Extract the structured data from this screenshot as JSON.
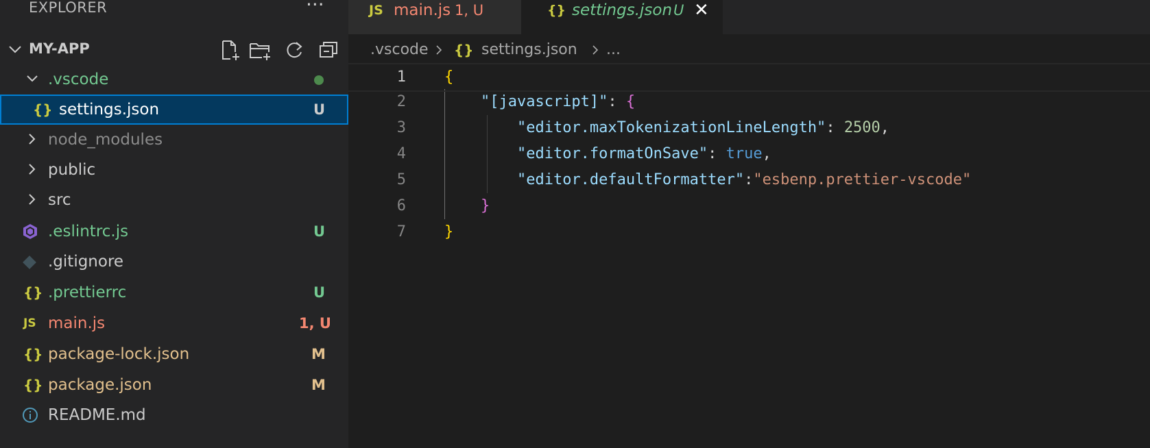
{
  "colors": {
    "sidebar_bg": "#252526",
    "editor_bg": "#1e1e1e",
    "selection_bg": "#04395e",
    "focus_border": "#007fd4",
    "untracked": "#73c991",
    "modified": "#e2c08d",
    "error": "#f48771",
    "ignored": "#8c8c8c"
  },
  "explorer": {
    "title": "EXPLORER",
    "more_actions": "···",
    "section_title": "MY-APP",
    "actions": [
      "new-file-icon",
      "new-folder-icon",
      "refresh-icon",
      "collapse-all-icon"
    ],
    "items": [
      {
        "name": ".vscode",
        "kind": "folder",
        "expanded": true,
        "badge": "",
        "decoration": "untracked-dot"
      },
      {
        "name": "settings.json",
        "kind": "json",
        "icon": "{}",
        "badge": "U",
        "selected": true
      },
      {
        "name": "node_modules",
        "kind": "folder",
        "expanded": false,
        "badge": ""
      },
      {
        "name": "public",
        "kind": "folder",
        "expanded": false,
        "badge": ""
      },
      {
        "name": "src",
        "kind": "folder",
        "expanded": false,
        "badge": ""
      },
      {
        "name": ".eslintrc.js",
        "kind": "eslint",
        "badge": "U"
      },
      {
        "name": ".gitignore",
        "kind": "git",
        "badge": ""
      },
      {
        "name": ".prettierrc",
        "kind": "json",
        "icon": "{}",
        "badge": "U"
      },
      {
        "name": "main.js",
        "kind": "js",
        "icon": "JS",
        "badge": "1, U"
      },
      {
        "name": "package-lock.json",
        "kind": "json",
        "icon": "{}",
        "badge": "M"
      },
      {
        "name": "package.json",
        "kind": "json",
        "icon": "{}",
        "badge": "M"
      },
      {
        "name": "README.md",
        "kind": "info",
        "badge": ""
      }
    ]
  },
  "tabs": [
    {
      "icon": "JS",
      "label": "main.js",
      "badge": "1, U",
      "active": false
    },
    {
      "icon": "{}",
      "label": "settings.json",
      "badge": "U",
      "active": true,
      "close": "✕"
    }
  ],
  "breadcrumb": [
    ".vscode",
    "settings.json",
    "..."
  ],
  "editor": {
    "lines": [
      {
        "n": "1",
        "text": "{"
      },
      {
        "n": "2",
        "text": "    \"[javascript]\": {"
      },
      {
        "n": "3",
        "text": "        \"editor.maxTokenizationLineLength\": 2500,"
      },
      {
        "n": "4",
        "text": "        \"editor.formatOnSave\": true,"
      },
      {
        "n": "5",
        "text": "        \"editor.defaultFormatter\":\"esbenp.prettier-vscode\""
      },
      {
        "n": "6",
        "text": "    }"
      },
      {
        "n": "7",
        "text": "}"
      }
    ],
    "tokens": {
      "l1_brace": "{",
      "l2_key": "\"[javascript]\"",
      "l2_colon": ": ",
      "l2_brace": "{",
      "l3_key": "\"editor.maxTokenizationLineLength\"",
      "l3_colon": ": ",
      "l3_num": "2500",
      "l3_comma": ",",
      "l4_key": "\"editor.formatOnSave\"",
      "l4_colon": ": ",
      "l4_bool": "true",
      "l4_comma": ",",
      "l5_key": "\"editor.defaultFormatter\"",
      "l5_colon": ":",
      "l5_str": "\"esbenp.prettier-vscode\"",
      "l6_brace": "}",
      "l7_brace": "}"
    }
  }
}
